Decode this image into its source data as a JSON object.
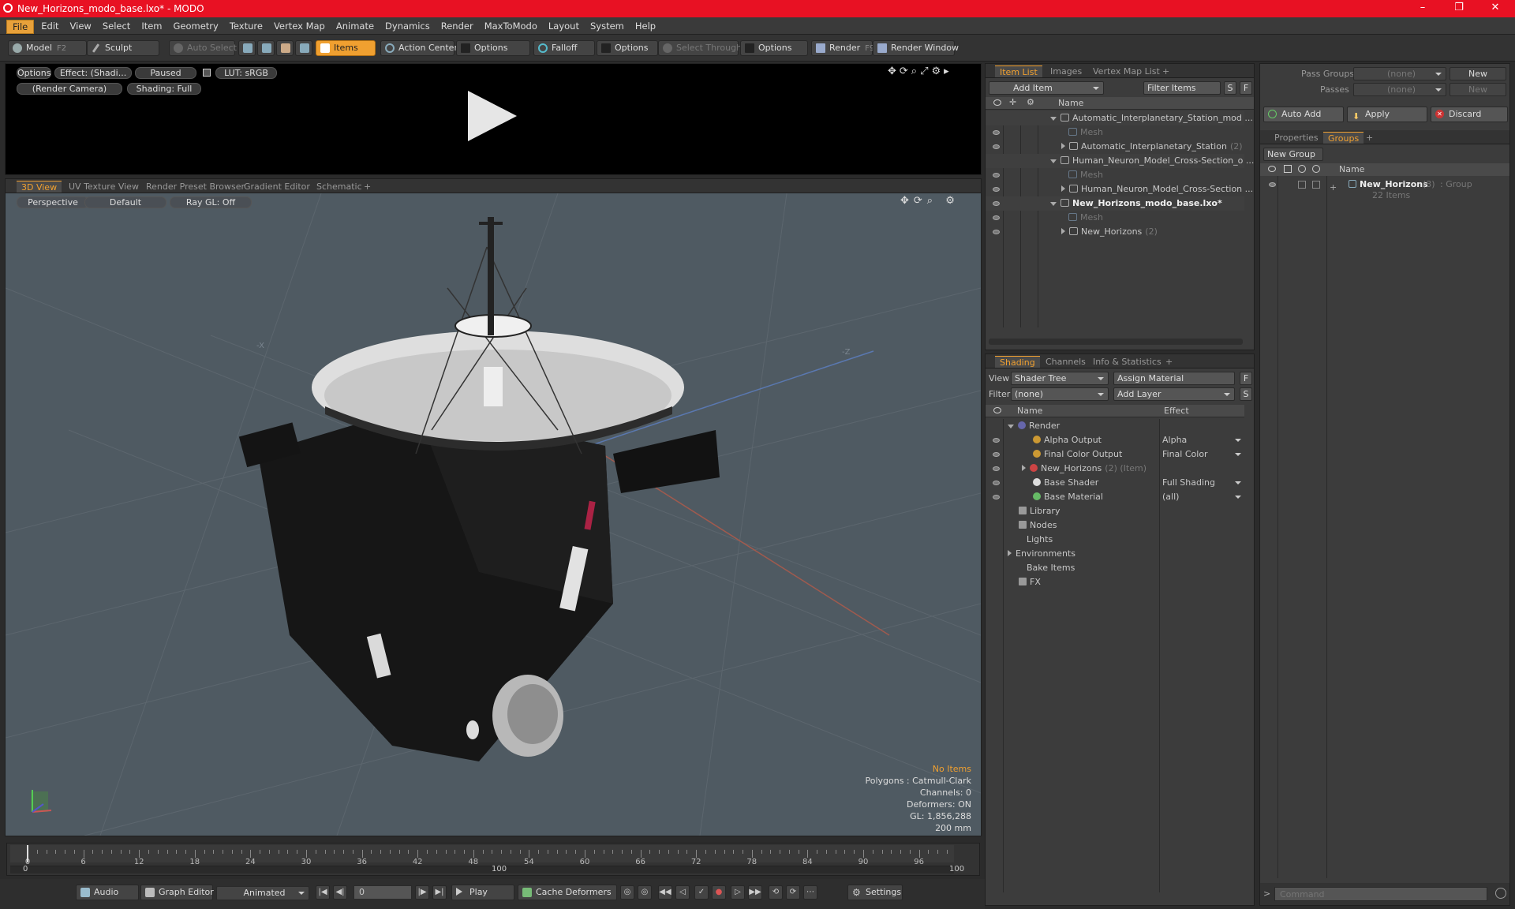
{
  "window": {
    "title": "New_Horizons_modo_base.lxo* - MODO",
    "minimize": "–",
    "maximize": "❐",
    "close": "✕"
  },
  "menu": [
    "File",
    "Edit",
    "View",
    "Select",
    "Item",
    "Geometry",
    "Texture",
    "Vertex Map",
    "Animate",
    "Dynamics",
    "Render",
    "MaxToModo",
    "Layout",
    "System",
    "Help"
  ],
  "toolbar": {
    "model": "Model",
    "model_key": "F2",
    "sculpt": "Sculpt",
    "auto_select": "Auto Select",
    "items": "Items",
    "action_center": "Action Center",
    "options1": "Options",
    "falloff": "Falloff",
    "options2": "Options",
    "select_through": "Select Through",
    "options3": "Options",
    "render": "Render",
    "render_key": "F9",
    "render_window": "Render Window"
  },
  "preview": {
    "options": "Options",
    "effect": "Effect: (Shadi...",
    "paused": "Paused",
    "lut": "LUT: sRGB",
    "camera": "(Render Camera)",
    "shading": "Shading: Full"
  },
  "viewport": {
    "tabs": [
      "3D View",
      "UV Texture View",
      "Render Preset Browser",
      "Gradient Editor",
      "Schematic"
    ],
    "perspective": "Perspective",
    "default": "Default",
    "raygl": "Ray GL: Off",
    "axis_x": "-X",
    "axis_z": "-Z",
    "stats": {
      "items": "No Items",
      "polygons": "Polygons : Catmull-Clark",
      "channels": "Channels: 0",
      "deformers": "Deformers: ON",
      "gl": "GL: 1,856,288",
      "scale": "200 mm"
    }
  },
  "item_list": {
    "tabs": [
      "Item List",
      "Images",
      "Vertex Map List"
    ],
    "add_item": "Add Item",
    "filter": "Filter Items",
    "s": "S",
    "f": "F",
    "col_name": "Name",
    "rows": [
      {
        "label": "Automatic_Interplanetary_Station_mod ...",
        "count": "",
        "style": "normal",
        "indent": 0
      },
      {
        "label": "Mesh",
        "count": "",
        "style": "gray",
        "indent": 1
      },
      {
        "label": "Automatic_Interplanetary_Station",
        "count": "(2)",
        "style": "normal",
        "indent": 1
      },
      {
        "label": "Human_Neuron_Model_Cross-Section_o ...",
        "count": "",
        "style": "normal",
        "indent": 0
      },
      {
        "label": "Mesh",
        "count": "",
        "style": "gray",
        "indent": 1
      },
      {
        "label": "Human_Neuron_Model_Cross-Section ...",
        "count": "",
        "style": "normal",
        "indent": 1
      },
      {
        "label": "New_Horizons_modo_base.lxo*",
        "count": "",
        "style": "bold",
        "indent": 0
      },
      {
        "label": "Mesh",
        "count": "",
        "style": "gray",
        "indent": 1
      },
      {
        "label": "New_Horizons",
        "count": "(2)",
        "style": "normal",
        "indent": 1
      }
    ]
  },
  "shading": {
    "tabs": [
      "Shading",
      "Channels",
      "Info & Statistics"
    ],
    "view_label": "View",
    "view_value": "Shader Tree",
    "assign": "Assign Material",
    "f": "F",
    "filter_label": "Filter",
    "filter_value": "(none)",
    "add_layer": "Add Layer",
    "s": "S",
    "col_name": "Name",
    "col_effect": "Effect",
    "rows": [
      {
        "label": "Render",
        "effect": "",
        "extra": ""
      },
      {
        "label": "Alpha Output",
        "effect": "Alpha",
        "extra": ""
      },
      {
        "label": "Final Color Output",
        "effect": "Final Color",
        "extra": ""
      },
      {
        "label": "New_Horizons",
        "effect": "",
        "extra": "(2) (Item)"
      },
      {
        "label": "Base Shader",
        "effect": "Full Shading",
        "extra": ""
      },
      {
        "label": "Base Material",
        "effect": "(all)",
        "extra": ""
      },
      {
        "label": "Library",
        "effect": "",
        "extra": ""
      },
      {
        "label": "Nodes",
        "effect": "",
        "extra": ""
      },
      {
        "label": "Lights",
        "effect": "",
        "extra": ""
      },
      {
        "label": "Environments",
        "effect": "",
        "extra": ""
      },
      {
        "label": "Bake Items",
        "effect": "",
        "extra": ""
      },
      {
        "label": "FX",
        "effect": "",
        "extra": ""
      }
    ]
  },
  "groups": {
    "pass_groups": "Pass Groups",
    "pass_value": "(none)",
    "new": "New",
    "passes": "Passes",
    "passes_value": "(none)",
    "new2": "New",
    "auto_add": "Auto Add",
    "apply": "Apply",
    "discard": "Discard",
    "tabs": [
      "Properties",
      "Groups"
    ],
    "new_group": "New Group",
    "col_name": "Name",
    "group_name": "New_Horizons",
    "group_count": "(3)",
    "group_type": ": Group",
    "group_items": "22 Items"
  },
  "timeline": {
    "ticks": [
      "0",
      "6",
      "12",
      "18",
      "24",
      "30",
      "36",
      "42",
      "48",
      "54",
      "60",
      "66",
      "72",
      "78",
      "84",
      "90",
      "96"
    ],
    "left": "0",
    "mid": "100",
    "right": "100"
  },
  "bottom": {
    "audio": "Audio",
    "graph_editor": "Graph Editor",
    "animated": "Animated",
    "frame": "0",
    "play": "Play",
    "cache": "Cache Deformers",
    "settings": "Settings"
  },
  "command": {
    "placeholder": "Command"
  }
}
